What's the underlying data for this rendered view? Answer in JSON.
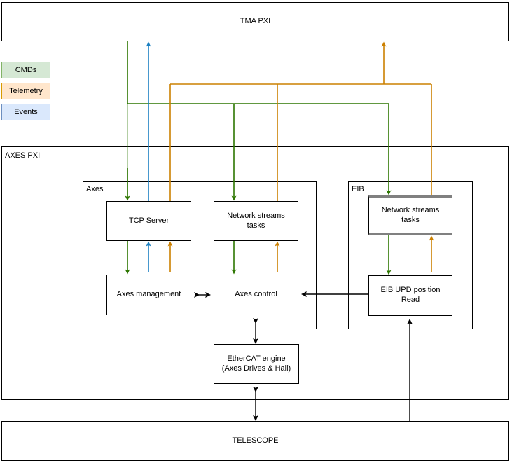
{
  "diagram": {
    "title_top": "TMA PXI",
    "title_bottom": "TELESCOPE",
    "legend": [
      {
        "id": "cmds",
        "label": "CMDs",
        "fill": "#d5e8d4",
        "stroke": "#82b366"
      },
      {
        "id": "telemetry",
        "label": "Telemetry",
        "fill": "#ffe6cc",
        "stroke": "#d79b00"
      },
      {
        "id": "events",
        "label": "Events",
        "fill": "#dae8fc",
        "stroke": "#6c8ebf"
      }
    ],
    "containers": [
      {
        "id": "axes-pxi",
        "label": "AXES PXI"
      },
      {
        "id": "axes",
        "label": "Axes"
      },
      {
        "id": "eib",
        "label": "EIB"
      }
    ],
    "nodes": [
      {
        "id": "tcp-server",
        "label": "TCP Server"
      },
      {
        "id": "axes-network-streams",
        "label": "Network streams\ntasks"
      },
      {
        "id": "axes-management",
        "label": "Axes management"
      },
      {
        "id": "axes-control",
        "label": "Axes control"
      },
      {
        "id": "eib-network-streams",
        "label": "Network streams\ntasks"
      },
      {
        "id": "eib-upd-position-read",
        "label": "EIB UPD position\nRead"
      },
      {
        "id": "ethercat-engine",
        "label": "EtherCAT engine\n(Axes Drives & Hall)"
      }
    ],
    "colors": {
      "cmds_line": "#2d7600",
      "telemetry_line": "#cc8000",
      "events_line": "#1a7fc1",
      "plain_line": "#000000",
      "highlight": "#808080"
    }
  }
}
